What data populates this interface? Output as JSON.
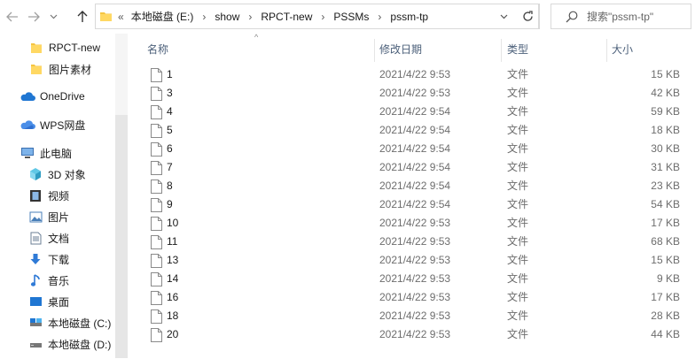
{
  "address": {
    "lead_sep": "«",
    "crumbs": [
      "本地磁盘 (E:)",
      "show",
      "RPCT-new",
      "PSSMs",
      "pssm-tp"
    ]
  },
  "search": {
    "placeholder": "搜索\"pssm-tp\""
  },
  "sidebar": {
    "items": [
      {
        "label": "RPCT-new",
        "icon": "folder-icon"
      },
      {
        "label": "图片素材",
        "icon": "folder-icon"
      },
      {
        "label": "OneDrive",
        "icon": "cloud-icon"
      },
      {
        "label": "WPS网盘",
        "icon": "wps-cloud-icon"
      },
      {
        "label": "此电脑",
        "icon": "computer-icon"
      },
      {
        "label": "3D 对象",
        "icon": "cube-icon"
      },
      {
        "label": "视频",
        "icon": "film-icon"
      },
      {
        "label": "图片",
        "icon": "picture-icon"
      },
      {
        "label": "文档",
        "icon": "document-icon"
      },
      {
        "label": "下载",
        "icon": "download-icon"
      },
      {
        "label": "音乐",
        "icon": "music-icon"
      },
      {
        "label": "桌面",
        "icon": "desktop-icon"
      },
      {
        "label": "本地磁盘 (C:)",
        "icon": "drive-icon"
      },
      {
        "label": "本地磁盘 (D:)",
        "icon": "drive-icon"
      }
    ]
  },
  "columns": {
    "name": "名称",
    "date": "修改日期",
    "type": "类型",
    "size": "大小"
  },
  "files": [
    {
      "name": "1",
      "date": "2021/4/22 9:53",
      "type": "文件",
      "size": "15 KB"
    },
    {
      "name": "3",
      "date": "2021/4/22 9:53",
      "type": "文件",
      "size": "42 KB"
    },
    {
      "name": "4",
      "date": "2021/4/22 9:54",
      "type": "文件",
      "size": "59 KB"
    },
    {
      "name": "5",
      "date": "2021/4/22 9:54",
      "type": "文件",
      "size": "18 KB"
    },
    {
      "name": "6",
      "date": "2021/4/22 9:54",
      "type": "文件",
      "size": "30 KB"
    },
    {
      "name": "7",
      "date": "2021/4/22 9:54",
      "type": "文件",
      "size": "31 KB"
    },
    {
      "name": "8",
      "date": "2021/4/22 9:54",
      "type": "文件",
      "size": "23 KB"
    },
    {
      "name": "9",
      "date": "2021/4/22 9:54",
      "type": "文件",
      "size": "54 KB"
    },
    {
      "name": "10",
      "date": "2021/4/22 9:53",
      "type": "文件",
      "size": "17 KB"
    },
    {
      "name": "11",
      "date": "2021/4/22 9:53",
      "type": "文件",
      "size": "68 KB"
    },
    {
      "name": "13",
      "date": "2021/4/22 9:53",
      "type": "文件",
      "size": "15 KB"
    },
    {
      "name": "14",
      "date": "2021/4/22 9:53",
      "type": "文件",
      "size": "9 KB"
    },
    {
      "name": "16",
      "date": "2021/4/22 9:53",
      "type": "文件",
      "size": "17 KB"
    },
    {
      "name": "18",
      "date": "2021/4/22 9:53",
      "type": "文件",
      "size": "28 KB"
    },
    {
      "name": "20",
      "date": "2021/4/22 9:53",
      "type": "文件",
      "size": "44 KB"
    }
  ],
  "colors": {
    "folder": "#f5c542",
    "onedrive": "#1f76d2",
    "header_text": "#4c607a"
  }
}
